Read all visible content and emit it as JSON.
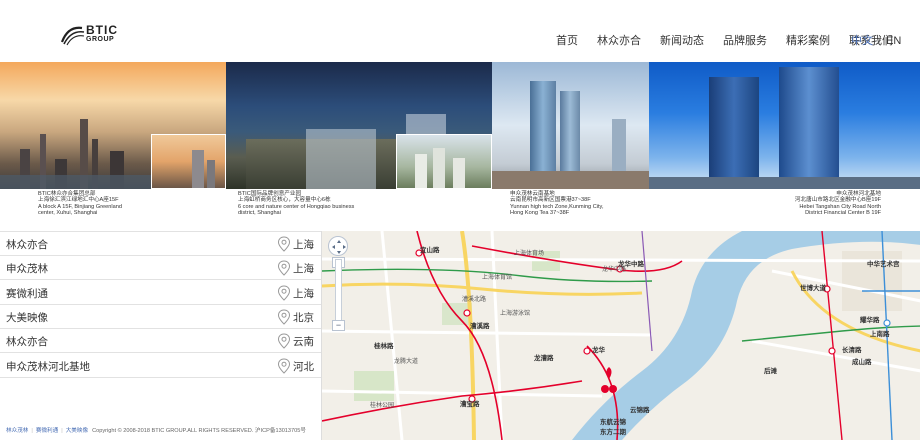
{
  "header": {
    "logo_text": "BTIC",
    "logo_sub": "GROUP",
    "nav": [
      "首页",
      "林众亦合",
      "新闻动态",
      "品牌服务",
      "精彩案例",
      "联系我们"
    ],
    "lang_zh": "中文",
    "lang_sep": "/",
    "lang_en": "EN"
  },
  "banner": [
    {
      "lines": [
        "BTIC林众亦合集团总部",
        "上海徐汇滨江绿地汇中心A座15F",
        "A block A 15F, Binjiang Greenland",
        "center, Xuhui, Shanghai"
      ]
    },
    {
      "lines": [
        "BTIC国际品牌创意产业园",
        "上海虹桥商务区核心，大容量中心6栋",
        "6 core and nature center of Hongqiao business",
        "district, Shanghai"
      ]
    },
    {
      "lines": [
        "申众茂林云南基地",
        "云南昆明市高新区国票港37~38F",
        "Yunnan high tech Zone,Kunming City,",
        "Hong Kong Tea 37~38F"
      ]
    },
    {
      "lines": [
        "申众茂林河北基地",
        "河北唐山市路北区金融中心B座19F",
        "Hebei Tangshan City Road North",
        "District Financial Center B 19F"
      ]
    }
  ],
  "locations": [
    {
      "name": "林众亦合",
      "city": "上海"
    },
    {
      "name": "申众茂林",
      "city": "上海"
    },
    {
      "name": "赛微利通",
      "city": "上海"
    },
    {
      "name": "大美映像",
      "city": "北京"
    },
    {
      "name": "林众亦合",
      "city": "云南"
    },
    {
      "name": "申众茂林河北基地",
      "city": "河北"
    }
  ],
  "map_labels": [
    {
      "text": "宜山路",
      "cls": "big"
    },
    {
      "text": "上海体育场",
      "cls": ""
    },
    {
      "text": "龙华中路",
      "cls": "big"
    },
    {
      "text": "上海体育馆",
      "cls": ""
    },
    {
      "text": "漕溪北路",
      "cls": ""
    },
    {
      "text": "上海游泳馆",
      "cls": ""
    },
    {
      "text": "漕溪路",
      "cls": "big"
    },
    {
      "text": "龙华",
      "cls": "big"
    },
    {
      "text": "龙漕路",
      "cls": "big"
    },
    {
      "text": "桂林公园",
      "cls": ""
    },
    {
      "text": "漕宝路",
      "cls": "big"
    },
    {
      "text": "东航云锦",
      "cls": "big"
    },
    {
      "text": "东方二期",
      "cls": "big"
    },
    {
      "text": "云锦路",
      "cls": "big"
    },
    {
      "text": "世博大道",
      "cls": "big"
    },
    {
      "text": "耀华路",
      "cls": "big"
    },
    {
      "text": "长清路",
      "cls": "big"
    },
    {
      "text": "后滩",
      "cls": "big"
    },
    {
      "text": "成山路",
      "cls": "big"
    },
    {
      "text": "中华艺术宫",
      "cls": "big"
    },
    {
      "text": "上南路",
      "cls": "big"
    },
    {
      "text": "桂林路",
      "cls": "big"
    },
    {
      "text": "龙腾大道",
      "cls": ""
    },
    {
      "text": "龙华中路",
      "cls": ""
    }
  ],
  "footer": {
    "links": [
      "林众茂林",
      "赛微利通",
      "大美映像"
    ],
    "copyright": "Copyright © 2008-2018 BTIC GROUP.ALL RIGHTS RESERVED. 沪ICP备13013705号"
  },
  "colors": {
    "accent": "#4a6fb5",
    "metro_red": "#e4002b",
    "metro_yellow": "#f2c400",
    "metro_green": "#2f9b4a",
    "metro_blue": "#3c8fd8",
    "river": "#a6cde6"
  }
}
